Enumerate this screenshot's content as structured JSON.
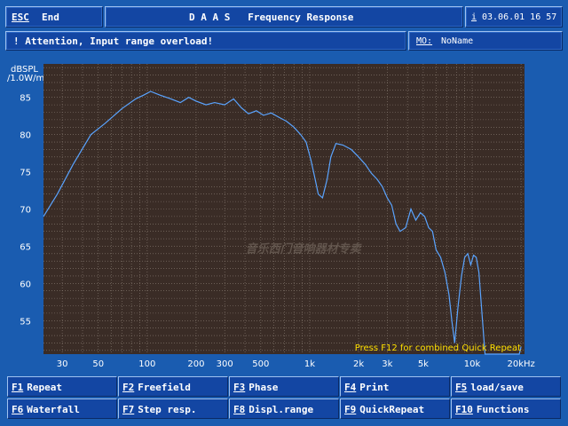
{
  "header": {
    "esc_key": "ESC",
    "esc_label": "End",
    "title": "D A A S   Frequency Response",
    "date_prefix": "i",
    "date": "03.06.01 16 57"
  },
  "status": {
    "attention": "! Attention, Input range overload!",
    "mo_label": "MO:",
    "mo_value": "NoName"
  },
  "chart_data": {
    "type": "line",
    "ylabel_top": "dBSPL",
    "ylabel_bottom": "/1.0W/m",
    "xunit": "kHz",
    "xscale": "log",
    "xlim": [
      23,
      21000
    ],
    "ylim": [
      50.5,
      89.5
    ],
    "yticks": [
      55,
      60,
      65,
      70,
      75,
      80,
      85
    ],
    "xticks": [
      {
        "v": 30,
        "t": "30"
      },
      {
        "v": 50,
        "t": "50"
      },
      {
        "v": 100,
        "t": "100"
      },
      {
        "v": 200,
        "t": "200"
      },
      {
        "v": 300,
        "t": "300"
      },
      {
        "v": 500,
        "t": "500"
      },
      {
        "v": 1000,
        "t": "1k"
      },
      {
        "v": 2000,
        "t": "2k"
      },
      {
        "v": 3000,
        "t": "3k"
      },
      {
        "v": 5000,
        "t": "5k"
      },
      {
        "v": 10000,
        "t": "10k"
      },
      {
        "v": 20000,
        "t": "20kHz"
      }
    ],
    "grid": true,
    "annotation": "Press F12 for combined Quick Repeat",
    "watermark": "音乐西门音响器材专卖",
    "series": [
      {
        "x": [
          23,
          28,
          35,
          45,
          55,
          70,
          85,
          95,
          105,
          120,
          140,
          160,
          180,
          200,
          230,
          260,
          300,
          340,
          380,
          420,
          470,
          520,
          580,
          650,
          720,
          800,
          880,
          950,
          1020,
          1080,
          1130,
          1200,
          1280,
          1350,
          1450,
          1600,
          1800,
          2000,
          2200,
          2400,
          2600,
          2800,
          3000,
          3200,
          3400,
          3600,
          3900,
          4200,
          4500,
          4800,
          5100,
          5400,
          5700,
          6000,
          6400,
          6800,
          7200,
          7500,
          7800,
          8200,
          8600,
          9000,
          9400,
          9800,
          10200,
          10600,
          11000,
          12000,
          14000,
          17000,
          19500,
          20000
        ],
        "y": [
          69,
          72,
          76,
          80,
          81.5,
          83.5,
          84.8,
          85.3,
          85.8,
          85.3,
          84.8,
          84.3,
          85.0,
          84.5,
          84.0,
          84.3,
          84.0,
          84.8,
          83.6,
          82.8,
          83.2,
          82.6,
          82.9,
          82.3,
          81.8,
          81.0,
          80.0,
          79.0,
          76.5,
          74.0,
          72.0,
          71.5,
          74.0,
          77.0,
          78.8,
          78.6,
          78.0,
          77.0,
          76.0,
          74.8,
          74.0,
          73.0,
          71.5,
          70.5,
          68.0,
          67.0,
          67.5,
          70.0,
          68.5,
          69.5,
          69.0,
          67.5,
          67.0,
          64.5,
          63.5,
          61.5,
          58.5,
          55.0,
          52.0,
          57.0,
          61.0,
          63.5,
          64.0,
          62.5,
          63.8,
          63.5,
          61.5,
          50.5,
          50.5,
          50.5,
          50.5,
          51.5
        ]
      }
    ]
  },
  "fkeys": [
    {
      "key": "F1",
      "label": "Repeat"
    },
    {
      "key": "F2",
      "label": "Freefield"
    },
    {
      "key": "F3",
      "label": "Phase"
    },
    {
      "key": "F4",
      "label": "Print"
    },
    {
      "key": "F5",
      "label": "load/save"
    },
    {
      "key": "F6",
      "label": "Waterfall"
    },
    {
      "key": "F7",
      "label": "Step resp."
    },
    {
      "key": "F8",
      "label": "Displ.range"
    },
    {
      "key": "F9",
      "label": "QuickRepeat"
    },
    {
      "key": "F10",
      "label": "Functions"
    }
  ],
  "colors": {
    "plot_bg": "#3a2c26",
    "grid": "#8a7e74",
    "curve": "#5aa4ff",
    "annotation": "#ffe000",
    "screen_bg": "#1a5cb0"
  }
}
